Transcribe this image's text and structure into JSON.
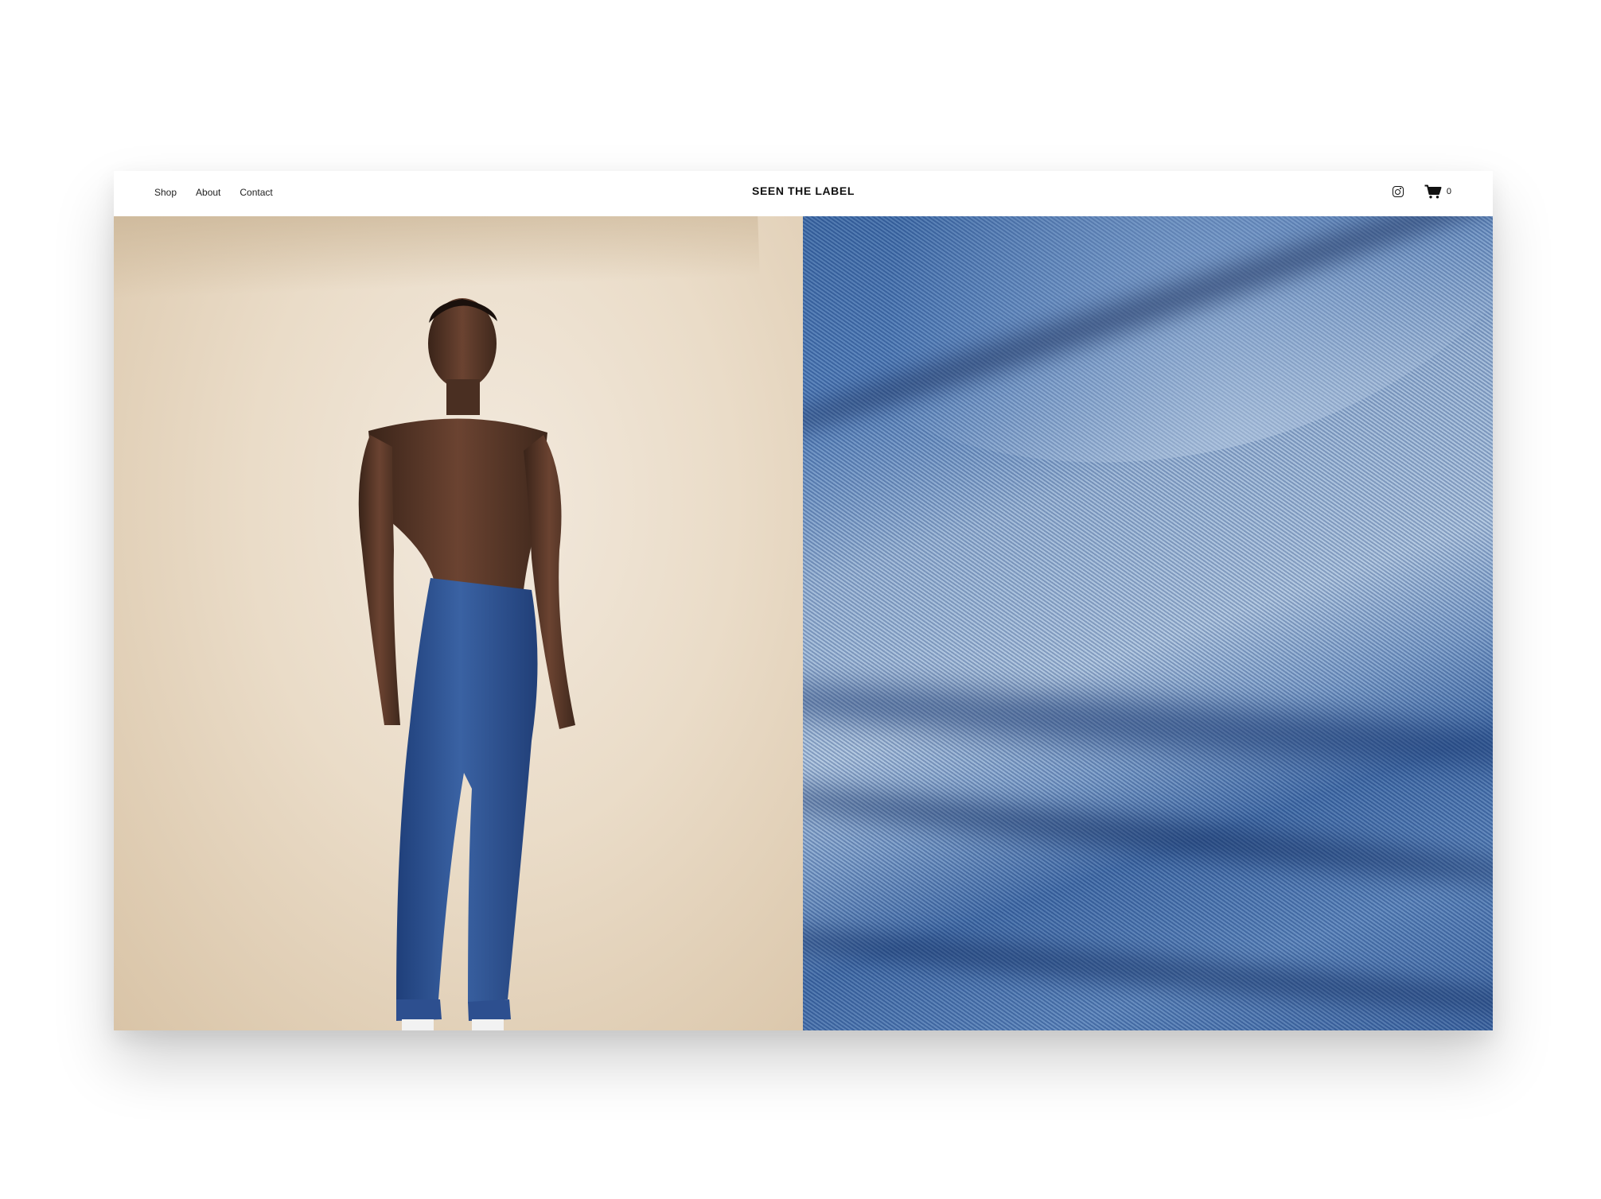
{
  "header": {
    "nav": [
      "Shop",
      "About",
      "Contact"
    ],
    "brand": "SEEN THE LABEL",
    "cart_count": "0"
  },
  "icons": {
    "social": "instagram-icon",
    "cart": "cart-icon"
  },
  "images": [
    {
      "name": "model-photo",
      "alt": "model wearing jeans"
    },
    {
      "name": "denim-closeup",
      "alt": "denim fabric close-up"
    }
  ],
  "colors": {
    "background": "#ffffff",
    "text": "#111111",
    "denim": "#4f7cb8",
    "backdrop": "#eadcc8"
  }
}
